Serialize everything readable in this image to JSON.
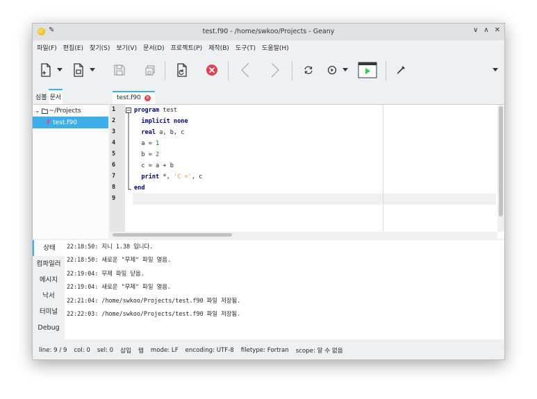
{
  "window": {
    "title": "test.f90 - /home/swkoo/Projects - Geany",
    "controls": {
      "minimize": "∨",
      "maximize": "∧",
      "close": "✕"
    }
  },
  "menu": [
    "파일(F)",
    "편집(E)",
    "찾기(S)",
    "보기(V)",
    "문서(D)",
    "프로젝트(P)",
    "제작(B)",
    "도구(T)",
    "도움말(H)"
  ],
  "toolbar": {
    "icons": [
      "new-file-icon",
      "open-file-icon",
      "save-icon",
      "save-all-icon",
      "revert-icon",
      "close-file-icon",
      "back-icon",
      "forward-icon",
      "reload-icon",
      "compile-icon",
      "run-icon",
      "color-picker-icon",
      "overflow-icon"
    ],
    "colors": {
      "close": "#da4453",
      "run": "#2ecc40"
    }
  },
  "sidebar": {
    "tabs": [
      "심볼",
      "문서"
    ],
    "tree": {
      "folder": "~/Projects",
      "file": "test.f90"
    }
  },
  "editor": {
    "tab_label": "test.f90",
    "line_numbers": [
      "1",
      "2",
      "3",
      "4",
      "5",
      "6",
      "7",
      "8",
      "9"
    ]
  },
  "messages": {
    "tabs": [
      "상태",
      "컴파일러",
      "메시지",
      "낙서",
      "터미널",
      "Debug"
    ],
    "rows": [
      "22:18:50: 지니 1.38 입니다.",
      "22:18:50: 새로운 \"무제\" 파일 열음.",
      "22:19:04: 무제 파일 닫음.",
      "22:19:04: 새로운 \"무제\" 파일 열음.",
      "22:21:04: /home/swkoo/Projects/test.f90 파일 저장됨.",
      "22:22:03: /home/swkoo/Projects/test.f90 파일 저장됨."
    ]
  },
  "status": {
    "line": "line: 9 / 9",
    "col": "col: 0",
    "sel": "sel: 0",
    "insert": "삽입",
    "tab": "탭",
    "mode": "mode: LF",
    "encoding": "encoding: UTF-8",
    "filetype": "filetype: Fortran",
    "scope": "scope: 알 수 없음"
  },
  "colors": {
    "accent": "#3daee9",
    "keyword": "#000080",
    "number": "#007f00",
    "string": "#ff901e"
  }
}
